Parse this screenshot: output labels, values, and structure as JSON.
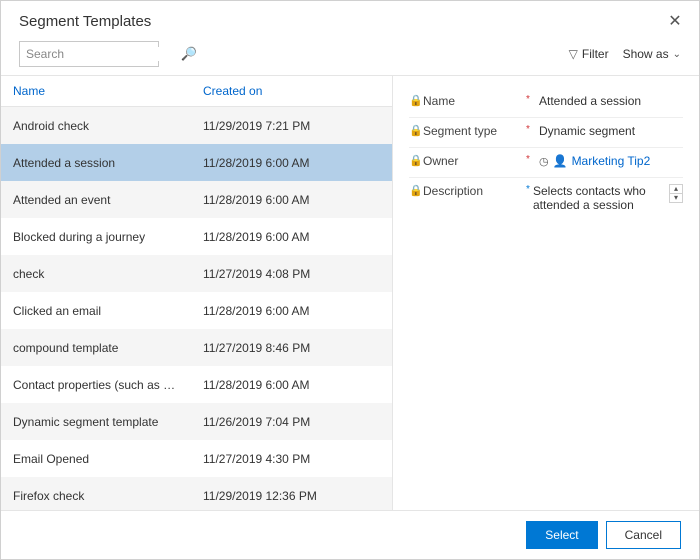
{
  "dialog": {
    "title": "Segment Templates",
    "search_placeholder": "Search",
    "filter_label": "Filter",
    "showas_label": "Show as"
  },
  "grid": {
    "columns": {
      "name": "Name",
      "created": "Created on"
    },
    "rows": [
      {
        "name": "Android check",
        "created": "11/29/2019 7:21 PM",
        "selected": false
      },
      {
        "name": "Attended a session",
        "created": "11/28/2019 6:00 AM",
        "selected": true
      },
      {
        "name": "Attended an event",
        "created": "11/28/2019 6:00 AM",
        "selected": false
      },
      {
        "name": "Blocked during a journey",
        "created": "11/28/2019 6:00 AM",
        "selected": false
      },
      {
        "name": "check",
        "created": "11/27/2019 4:08 PM",
        "selected": false
      },
      {
        "name": "Clicked an email",
        "created": "11/28/2019 6:00 AM",
        "selected": false
      },
      {
        "name": "compound template",
        "created": "11/27/2019 8:46 PM",
        "selected": false
      },
      {
        "name": "Contact properties (such as by city)",
        "created": "11/28/2019 6:00 AM",
        "selected": false
      },
      {
        "name": "Dynamic segment template",
        "created": "11/26/2019 7:04 PM",
        "selected": false
      },
      {
        "name": "Email Opened",
        "created": "11/27/2019 4:30 PM",
        "selected": false
      },
      {
        "name": "Firefox check",
        "created": "11/29/2019 12:36 PM",
        "selected": false
      }
    ]
  },
  "details": {
    "fields": {
      "name": {
        "label": "Name",
        "value": "Attended a session",
        "req": "*"
      },
      "type": {
        "label": "Segment type",
        "value": "Dynamic segment",
        "req": "*"
      },
      "owner": {
        "label": "Owner",
        "value": "Marketing Tip2",
        "req": "*"
      },
      "desc": {
        "label": "Description",
        "value": "Selects contacts who attended a session",
        "req": "*"
      }
    }
  },
  "footer": {
    "select": "Select",
    "cancel": "Cancel"
  }
}
